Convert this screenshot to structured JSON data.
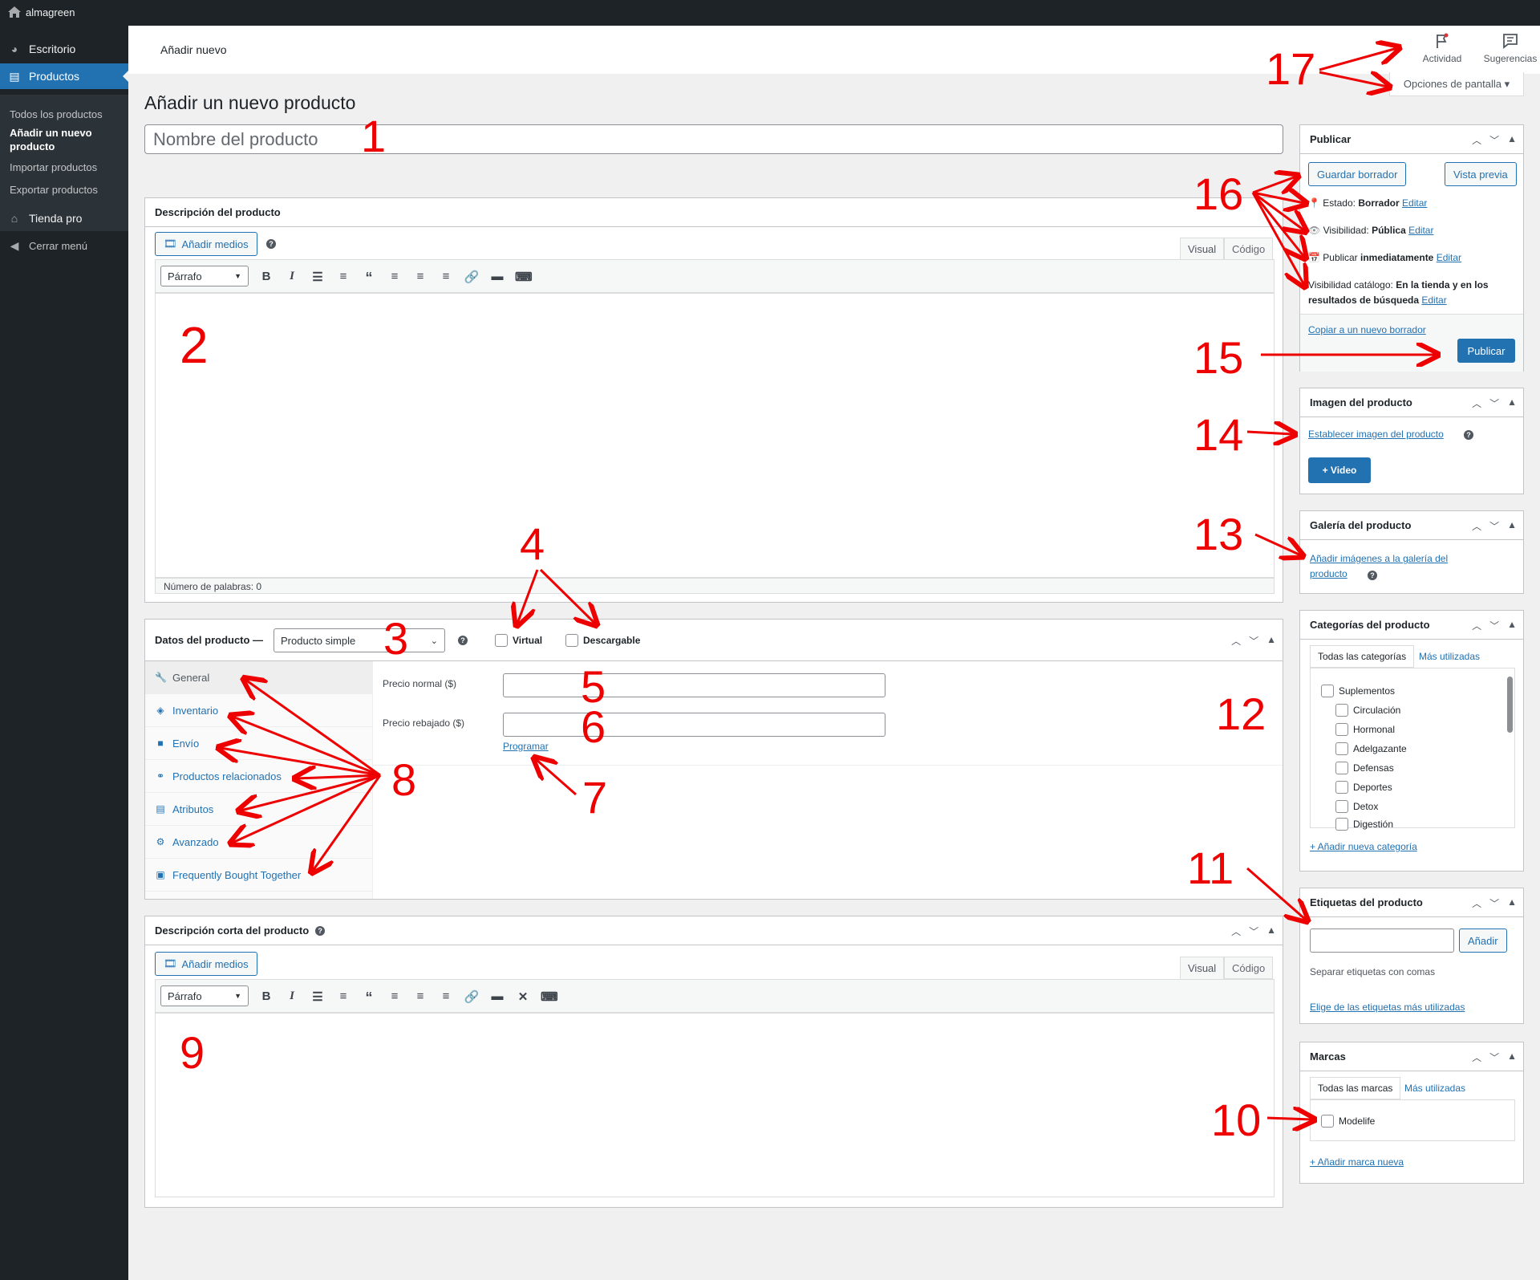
{
  "adminbar": {
    "site_name": "almagreen"
  },
  "sidebar": {
    "items": [
      {
        "label": "Escritorio",
        "icon": "dashboard-icon"
      },
      {
        "label": "Productos",
        "icon": "archive-icon"
      },
      {
        "label": "Tienda pro",
        "icon": "store-icon"
      },
      {
        "label": "Cerrar menú",
        "icon": "collapse-icon"
      }
    ],
    "submenu": [
      "Todos los productos",
      "Añadir un nuevo producto",
      "Importar productos",
      "Exportar productos"
    ]
  },
  "header": {
    "title": "Añadir nuevo",
    "activity": "Actividad",
    "suggestions": "Sugerencias",
    "screen_options": "Opciones de pantalla ▾"
  },
  "page": {
    "title": "Añadir un nuevo producto",
    "name_placeholder": "Nombre del producto"
  },
  "description": {
    "title": "Descripción del producto",
    "add_media": "Añadir medios",
    "tab_visual": "Visual",
    "tab_code": "Código",
    "format": "Párrafo",
    "word_count": "Número de palabras: 0"
  },
  "product_data": {
    "title": "Datos del producto —",
    "type": "Producto simple",
    "virtual": "Virtual",
    "downloadable": "Descargable",
    "tabs": [
      "General",
      "Inventario",
      "Envío",
      "Productos relacionados",
      "Atributos",
      "Avanzado",
      "Frequently Bought Together"
    ],
    "regular_price": "Precio normal ($)",
    "sale_price": "Precio rebajado ($)",
    "schedule": "Programar"
  },
  "short_description": {
    "title": "Descripción corta del producto",
    "add_media": "Añadir medios",
    "tab_visual": "Visual",
    "tab_code": "Código",
    "format": "Párrafo"
  },
  "publish": {
    "title": "Publicar",
    "save_draft": "Guardar borrador",
    "preview": "Vista previa",
    "status_label": "Estado:",
    "status_value": "Borrador",
    "visibility_label": "Visibilidad:",
    "visibility_value": "Pública",
    "publish_label": "Publicar",
    "publish_value": "inmediatamente",
    "catalog_label": "Visibilidad catálogo:",
    "catalog_value": "En la tienda y en los resultados de búsqueda",
    "edit": "Editar",
    "copy_draft": "Copiar a un nuevo borrador",
    "publish_button": "Publicar"
  },
  "image": {
    "title": "Imagen del producto",
    "set_image": "Establecer imagen del producto",
    "video": "+ Video"
  },
  "gallery": {
    "title": "Galería del producto",
    "add_images": "Añadir imágenes a la galería del producto"
  },
  "categories": {
    "title": "Categorías del producto",
    "tab_all": "Todas las categorías",
    "tab_most": "Más utilizadas",
    "items": [
      "Suplementos",
      "Circulación",
      "Hormonal",
      "Adelgazante",
      "Defensas",
      "Deportes",
      "Detox",
      "Digestión"
    ],
    "add": "+ Añadir nueva categoría"
  },
  "tags": {
    "title": "Etiquetas del producto",
    "add": "Añadir",
    "hint": "Separar etiquetas con comas",
    "most_used": "Elige de las etiquetas más utilizadas"
  },
  "brands": {
    "title": "Marcas",
    "tab_all": "Todas las marcas",
    "tab_most": "Más utilizadas",
    "items": [
      "Modelife"
    ],
    "add": "+ Añadir marca nueva"
  },
  "annotations": [
    "1",
    "2",
    "3",
    "4",
    "5",
    "6",
    "7",
    "8",
    "9",
    "10",
    "11",
    "12",
    "13",
    "14",
    "15",
    "16",
    "17"
  ]
}
